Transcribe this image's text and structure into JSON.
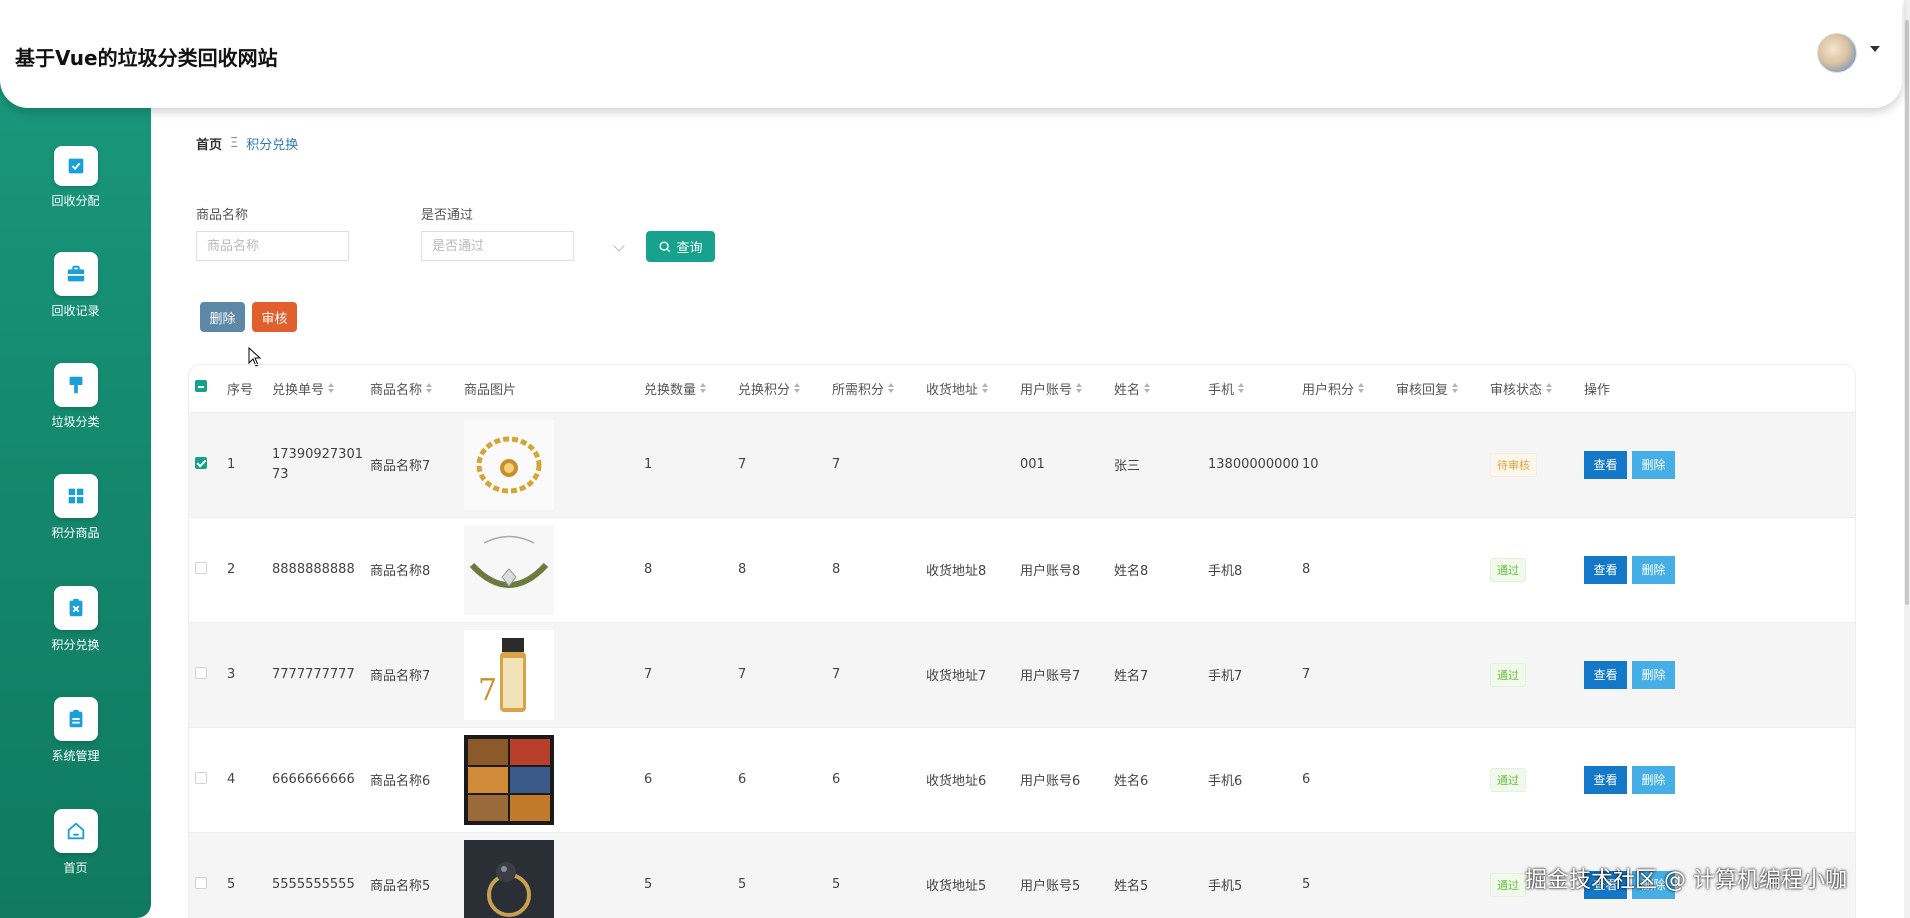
{
  "header": {
    "title": "基于Vue的垃圾分类回收网站"
  },
  "sidebar": {
    "items": [
      {
        "label": "回收分配",
        "icon": "check-square-icon"
      },
      {
        "label": "回收记录",
        "icon": "briefcase-icon"
      },
      {
        "label": "垃圾分类",
        "icon": "brush-icon"
      },
      {
        "label": "积分商品",
        "icon": "grid-icon"
      },
      {
        "label": "积分兑换",
        "icon": "clipboard-x-icon"
      },
      {
        "label": "系统管理",
        "icon": "clipboard-icon"
      },
      {
        "label": "首页",
        "icon": "home-icon"
      }
    ]
  },
  "breadcrumb": {
    "home": "首页",
    "separator": "Ξ",
    "current": "积分兑换"
  },
  "search": {
    "name_label": "商品名称",
    "name_placeholder": "商品名称",
    "pass_label": "是否通过",
    "pass_placeholder": "是否通过",
    "query_label": "查询"
  },
  "toolbar": {
    "delete_label": "删除",
    "audit_label": "审核"
  },
  "table": {
    "headers": [
      "序号",
      "兑换单号",
      "商品名称",
      "商品图片",
      "兑换数量",
      "兑换积分",
      "所需积分",
      "收货地址",
      "用户账号",
      "姓名",
      "手机",
      "用户积分",
      "审核回复",
      "审核状态",
      "操作"
    ],
    "view_label": "查看",
    "delete_label": "删除",
    "rows": [
      {
        "index": "1",
        "order": "1739092730173",
        "name": "商品名称7",
        "qty": "1",
        "points": "7",
        "need": "7",
        "address": "",
        "account": "001",
        "person": "张三",
        "phone": "13800000000",
        "user_points": "10",
        "reply": "",
        "status": "待审核",
        "status_type": "pending",
        "checked": true,
        "image": "bracelet"
      },
      {
        "index": "2",
        "order": "8888888888",
        "name": "商品名称8",
        "qty": "8",
        "points": "8",
        "need": "8",
        "address": "收货地址8",
        "account": "用户账号8",
        "person": "姓名8",
        "phone": "手机8",
        "user_points": "8",
        "reply": "",
        "status": "通过",
        "status_type": "pass",
        "checked": false,
        "image": "bracelet2"
      },
      {
        "index": "3",
        "order": "7777777777",
        "name": "商品名称7",
        "qty": "7",
        "points": "7",
        "need": "7",
        "address": "收货地址7",
        "account": "用户账号7",
        "person": "姓名7",
        "phone": "手机7",
        "user_points": "7",
        "reply": "",
        "status": "通过",
        "status_type": "pass",
        "checked": false,
        "image": "bottle"
      },
      {
        "index": "4",
        "order": "6666666666",
        "name": "商品名称6",
        "qty": "6",
        "points": "6",
        "need": "6",
        "address": "收货地址6",
        "account": "用户账号6",
        "person": "姓名6",
        "phone": "手机6",
        "user_points": "6",
        "reply": "",
        "status": "通过",
        "status_type": "pass",
        "checked": false,
        "image": "collage"
      },
      {
        "index": "5",
        "order": "5555555555",
        "name": "商品名称5",
        "qty": "5",
        "points": "5",
        "need": "5",
        "address": "收货地址5",
        "account": "用户账号5",
        "person": "姓名5",
        "phone": "手机5",
        "user_points": "5",
        "reply": "",
        "status": "通过",
        "status_type": "pass",
        "checked": false,
        "image": "ring"
      }
    ]
  },
  "watermark": "掘金技术社区 @ 计算机编程小咖",
  "colors": {
    "sidebar": "#13876c",
    "primary": "#16a28c",
    "delete": "#5d87a6",
    "audit": "#e15e2d",
    "view": "#1478c8",
    "row_delete": "#45aee6"
  }
}
